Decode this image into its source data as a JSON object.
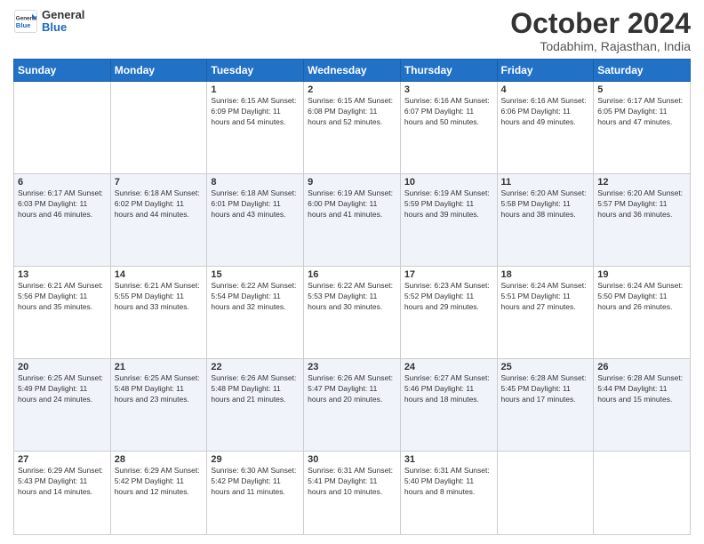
{
  "logo": {
    "text_general": "General",
    "text_blue": "Blue"
  },
  "header": {
    "month": "October 2024",
    "location": "Todabhim, Rajasthan, India"
  },
  "days_of_week": [
    "Sunday",
    "Monday",
    "Tuesday",
    "Wednesday",
    "Thursday",
    "Friday",
    "Saturday"
  ],
  "weeks": [
    [
      {
        "day": "",
        "info": ""
      },
      {
        "day": "",
        "info": ""
      },
      {
        "day": "1",
        "info": "Sunrise: 6:15 AM\nSunset: 6:09 PM\nDaylight: 11 hours and 54 minutes."
      },
      {
        "day": "2",
        "info": "Sunrise: 6:15 AM\nSunset: 6:08 PM\nDaylight: 11 hours and 52 minutes."
      },
      {
        "day": "3",
        "info": "Sunrise: 6:16 AM\nSunset: 6:07 PM\nDaylight: 11 hours and 50 minutes."
      },
      {
        "day": "4",
        "info": "Sunrise: 6:16 AM\nSunset: 6:06 PM\nDaylight: 11 hours and 49 minutes."
      },
      {
        "day": "5",
        "info": "Sunrise: 6:17 AM\nSunset: 6:05 PM\nDaylight: 11 hours and 47 minutes."
      }
    ],
    [
      {
        "day": "6",
        "info": "Sunrise: 6:17 AM\nSunset: 6:03 PM\nDaylight: 11 hours and 46 minutes."
      },
      {
        "day": "7",
        "info": "Sunrise: 6:18 AM\nSunset: 6:02 PM\nDaylight: 11 hours and 44 minutes."
      },
      {
        "day": "8",
        "info": "Sunrise: 6:18 AM\nSunset: 6:01 PM\nDaylight: 11 hours and 43 minutes."
      },
      {
        "day": "9",
        "info": "Sunrise: 6:19 AM\nSunset: 6:00 PM\nDaylight: 11 hours and 41 minutes."
      },
      {
        "day": "10",
        "info": "Sunrise: 6:19 AM\nSunset: 5:59 PM\nDaylight: 11 hours and 39 minutes."
      },
      {
        "day": "11",
        "info": "Sunrise: 6:20 AM\nSunset: 5:58 PM\nDaylight: 11 hours and 38 minutes."
      },
      {
        "day": "12",
        "info": "Sunrise: 6:20 AM\nSunset: 5:57 PM\nDaylight: 11 hours and 36 minutes."
      }
    ],
    [
      {
        "day": "13",
        "info": "Sunrise: 6:21 AM\nSunset: 5:56 PM\nDaylight: 11 hours and 35 minutes."
      },
      {
        "day": "14",
        "info": "Sunrise: 6:21 AM\nSunset: 5:55 PM\nDaylight: 11 hours and 33 minutes."
      },
      {
        "day": "15",
        "info": "Sunrise: 6:22 AM\nSunset: 5:54 PM\nDaylight: 11 hours and 32 minutes."
      },
      {
        "day": "16",
        "info": "Sunrise: 6:22 AM\nSunset: 5:53 PM\nDaylight: 11 hours and 30 minutes."
      },
      {
        "day": "17",
        "info": "Sunrise: 6:23 AM\nSunset: 5:52 PM\nDaylight: 11 hours and 29 minutes."
      },
      {
        "day": "18",
        "info": "Sunrise: 6:24 AM\nSunset: 5:51 PM\nDaylight: 11 hours and 27 minutes."
      },
      {
        "day": "19",
        "info": "Sunrise: 6:24 AM\nSunset: 5:50 PM\nDaylight: 11 hours and 26 minutes."
      }
    ],
    [
      {
        "day": "20",
        "info": "Sunrise: 6:25 AM\nSunset: 5:49 PM\nDaylight: 11 hours and 24 minutes."
      },
      {
        "day": "21",
        "info": "Sunrise: 6:25 AM\nSunset: 5:48 PM\nDaylight: 11 hours and 23 minutes."
      },
      {
        "day": "22",
        "info": "Sunrise: 6:26 AM\nSunset: 5:48 PM\nDaylight: 11 hours and 21 minutes."
      },
      {
        "day": "23",
        "info": "Sunrise: 6:26 AM\nSunset: 5:47 PM\nDaylight: 11 hours and 20 minutes."
      },
      {
        "day": "24",
        "info": "Sunrise: 6:27 AM\nSunset: 5:46 PM\nDaylight: 11 hours and 18 minutes."
      },
      {
        "day": "25",
        "info": "Sunrise: 6:28 AM\nSunset: 5:45 PM\nDaylight: 11 hours and 17 minutes."
      },
      {
        "day": "26",
        "info": "Sunrise: 6:28 AM\nSunset: 5:44 PM\nDaylight: 11 hours and 15 minutes."
      }
    ],
    [
      {
        "day": "27",
        "info": "Sunrise: 6:29 AM\nSunset: 5:43 PM\nDaylight: 11 hours and 14 minutes."
      },
      {
        "day": "28",
        "info": "Sunrise: 6:29 AM\nSunset: 5:42 PM\nDaylight: 11 hours and 12 minutes."
      },
      {
        "day": "29",
        "info": "Sunrise: 6:30 AM\nSunset: 5:42 PM\nDaylight: 11 hours and 11 minutes."
      },
      {
        "day": "30",
        "info": "Sunrise: 6:31 AM\nSunset: 5:41 PM\nDaylight: 11 hours and 10 minutes."
      },
      {
        "day": "31",
        "info": "Sunrise: 6:31 AM\nSunset: 5:40 PM\nDaylight: 11 hours and 8 minutes."
      },
      {
        "day": "",
        "info": ""
      },
      {
        "day": "",
        "info": ""
      }
    ]
  ]
}
